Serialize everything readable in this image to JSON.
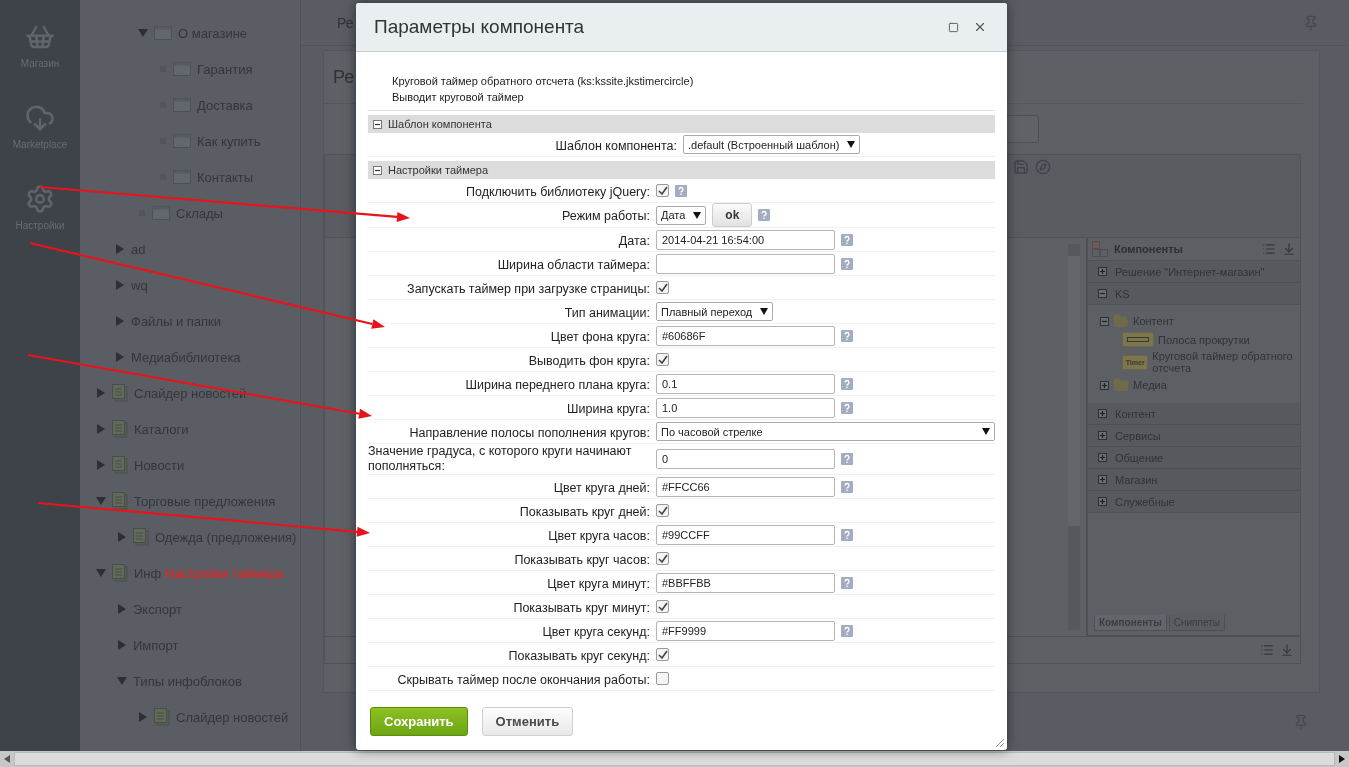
{
  "sidebar": {
    "items": [
      {
        "label": "Магазин",
        "kind": "basket"
      },
      {
        "label": "Marketplace",
        "kind": "cloud"
      },
      {
        "label": "Настройки",
        "kind": "gear"
      }
    ]
  },
  "tree": [
    {
      "label": "О магазине",
      "kind": "folder",
      "expanded": true,
      "children": [
        {
          "label": "Гарантия",
          "kind": "folder"
        },
        {
          "label": "Доставка",
          "kind": "folder"
        },
        {
          "label": "Как купить",
          "kind": "folder"
        },
        {
          "label": "Контакты",
          "kind": "folder"
        }
      ]
    },
    {
      "label": "Склады",
      "kind": "folder"
    },
    {
      "label": "ad",
      "kind": "section",
      "expanded": false
    },
    {
      "label": "wq",
      "kind": "section",
      "expanded": false
    },
    {
      "label": "Файлы и папки",
      "kind": "section",
      "expanded": false
    },
    {
      "label": "Медиабиблиотека",
      "kind": "section",
      "expanded": false
    },
    {
      "label": "Слайдер новостей",
      "kind": "iblock",
      "expanded": false
    },
    {
      "label": "Каталоги",
      "kind": "iblock",
      "expanded": false
    },
    {
      "label": "Новости",
      "kind": "iblock",
      "expanded": false
    },
    {
      "label": "Торговые предложения",
      "kind": "iblock",
      "expanded": true,
      "children": [
        {
          "label": "Одежда (предложения)",
          "kind": "iblock",
          "expanded": false
        }
      ]
    },
    {
      "label": "Инф",
      "kind": "iblock",
      "expanded": true,
      "children": [
        {
          "label": "Экспорт",
          "kind": "section",
          "expanded": false
        },
        {
          "label": "Импорт",
          "kind": "section",
          "expanded": false
        },
        {
          "label": "Типы инфоблоков",
          "kind": "section",
          "expanded": true,
          "children": [
            {
              "label": "Слайдер новостей",
              "kind": "iblock",
              "expanded": false
            }
          ]
        }
      ]
    }
  ],
  "main": {
    "header_title": "Ре",
    "page_title": "Ре"
  },
  "components_panel": {
    "title": "Компоненты",
    "groups": [
      {
        "label": "Решение \"Интернет-магазин\"",
        "expanded": false
      },
      {
        "label": "KS",
        "expanded": true,
        "children": [
          {
            "label": "Контент",
            "expanded": true,
            "children": [
              {
                "label": "Полоса прокрутки",
                "kind": "scrollbar"
              },
              {
                "label": "Круговой таймер обратного отсчета",
                "kind": "timer",
                "badge": "Timer"
              }
            ]
          },
          {
            "label": "Медиа",
            "expanded": false
          }
        ]
      },
      {
        "label": "Контент",
        "expanded": false
      },
      {
        "label": "Сервисы",
        "expanded": false
      },
      {
        "label": "Общение",
        "expanded": false
      },
      {
        "label": "Магазин",
        "expanded": false
      },
      {
        "label": "Служебные",
        "expanded": false
      }
    ],
    "tabs": [
      {
        "label": "Компоненты",
        "selected": true
      },
      {
        "label": "Сниппеты",
        "selected": false
      }
    ]
  },
  "dialog": {
    "title": "Параметры компонента",
    "description": [
      "Круговой таймер обратного отсчета (ks:kssite.jkstimercircle)",
      "Выводит круговой таймер"
    ],
    "sections": [
      {
        "title": "Шаблон компонента",
        "expanded": true,
        "rows": [
          {
            "label": "Шаблон компонента:",
            "kind": "select",
            "value": ".default (Встроенный шаблон)",
            "help": false
          }
        ]
      },
      {
        "title": "Настройки таймера",
        "expanded": true,
        "rows": [
          {
            "label": "Подключить библиотеку jQuery:",
            "kind": "checkbox",
            "checked": true,
            "help": true
          },
          {
            "label": "Режим работы:",
            "kind": "select",
            "value": "Дата",
            "button": "ok",
            "help": true
          },
          {
            "label": "Дата:",
            "kind": "input",
            "value": "2014-04-21 16:54:00",
            "help": true
          },
          {
            "label": "Ширина области таймера:",
            "kind": "input",
            "help": true
          },
          {
            "label": "Запускать таймер при загрузке страницы:",
            "kind": "checkbox",
            "checked": true,
            "help": false
          },
          {
            "label": "Тип анимации:",
            "kind": "select",
            "value": "Плавный переход",
            "help": false
          },
          {
            "label": "Цвет фона круга:",
            "kind": "input",
            "value": "#60686F",
            "help": true
          },
          {
            "label": "Выводить фон круга:",
            "kind": "checkbox",
            "checked": true,
            "help": false
          },
          {
            "label": "Ширина переднего плана круга:",
            "kind": "input",
            "value": "0.1",
            "help": true
          },
          {
            "label": "Ширина круга:",
            "kind": "input",
            "value": "1.0",
            "help": true
          },
          {
            "label": "Направление полосы пополнения кругов:",
            "kind": "select-wide",
            "value": "По часовой стрелке",
            "help": false
          },
          {
            "label": "Значение градуса, с которого круги начинают пополняться:",
            "kind": "input",
            "value": "0",
            "help": true
          },
          {
            "label": "Цвет круга дней:",
            "kind": "input",
            "value": "#FFCC66",
            "help": true
          },
          {
            "label": "Показывать круг дней:",
            "kind": "checkbox",
            "checked": true,
            "help": false
          },
          {
            "label": "Цвет круга часов:",
            "kind": "input",
            "value": "#99CCFF",
            "help": true
          },
          {
            "label": "Показывать круг часов:",
            "kind": "checkbox",
            "checked": true,
            "help": false
          },
          {
            "label": "Цвет круга минут:",
            "kind": "input",
            "value": "#BBFFBB",
            "help": true
          },
          {
            "label": "Показывать круг минут:",
            "kind": "checkbox",
            "checked": true,
            "help": false
          },
          {
            "label": "Цвет круга секунд:",
            "kind": "input",
            "value": "#FF9999",
            "help": true
          },
          {
            "label": "Показывать круг секунд:",
            "kind": "checkbox",
            "checked": true,
            "help": false
          },
          {
            "label": "Скрывать таймер после окончания работы:",
            "kind": "checkbox",
            "checked": false,
            "help": false
          }
        ]
      }
    ],
    "buttons": [
      {
        "label": "Сохранить",
        "kind": "primary"
      },
      {
        "label": "Отменить",
        "kind": "secondary"
      }
    ]
  },
  "annotation": {
    "text": "Настройки таймера"
  }
}
